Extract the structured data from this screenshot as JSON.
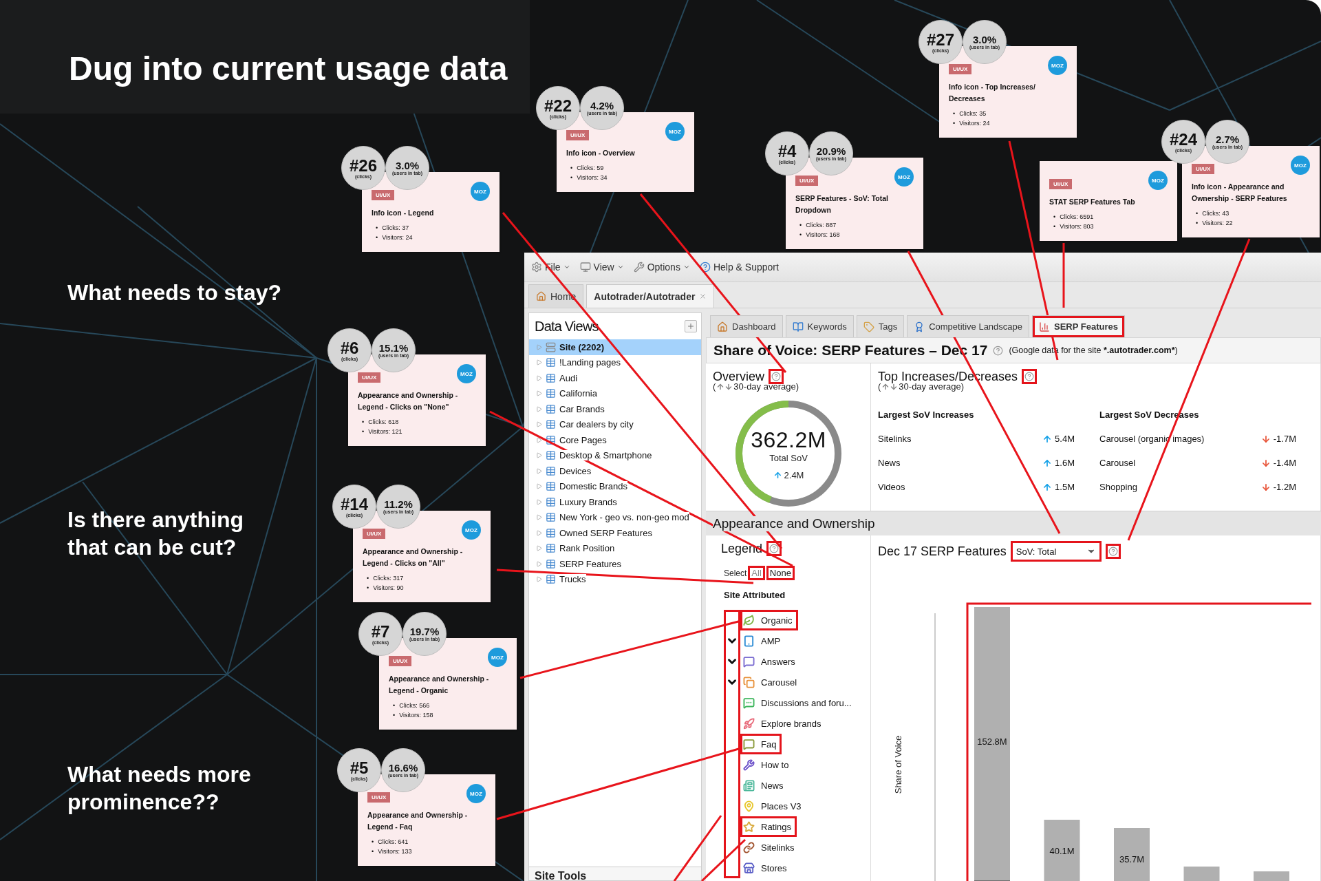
{
  "slide": {
    "title": "Dug into current usage data",
    "questions": [
      "What needs to stay?",
      "Is there anything\nthat can be cut?",
      "What needs more\nprominence??"
    ]
  },
  "notes": [
    {
      "rank": "#27",
      "rank_caption": "(clicks)",
      "share": "3.0%",
      "share_caption": "(users in tab)",
      "tag": "UI/UX",
      "logo": "MOZ",
      "title": "Info icon - Top Increases/ Decreases",
      "bullet": "•",
      "stats": [
        "Clicks: 35",
        "Visitors: 24"
      ]
    },
    {
      "rank": "#22",
      "rank_caption": "(clicks)",
      "share": "4.2%",
      "share_caption": "(users in tab)",
      "tag": "UI/UX",
      "logo": "MOZ",
      "title": "Info icon - Overview",
      "bullet": "•",
      "stats": [
        "Clicks: 59",
        "Visitors: 34"
      ]
    },
    {
      "rank": "#24",
      "rank_caption": "(clicks)",
      "share": "2.7%",
      "share_caption": "(users in tab)",
      "tag": "UI/UX",
      "logo": "MOZ",
      "title": "Info icon - Appearance and Ownership - SERP Features",
      "bullet": "•",
      "stats": [
        "Clicks: 43",
        "Visitors: 22"
      ]
    },
    {
      "rank": "#4",
      "rank_caption": "(clicks)",
      "share": "20.9%",
      "share_caption": "(users in tab)",
      "tag": "UI/UX",
      "logo": "MOZ",
      "title": "SERP Features - SoV: Total Dropdown",
      "bullet": "•",
      "stats": [
        "Clicks: 887",
        "Visitors: 168"
      ]
    },
    {
      "tag": "UI/UX",
      "logo": "MOZ",
      "title": "STAT SERP Features Tab",
      "bullet": "•",
      "stats": [
        "Clicks: 6591",
        "Visitors: 803"
      ]
    },
    {
      "rank": "#26",
      "rank_caption": "(clicks)",
      "share": "3.0%",
      "share_caption": "(users in tab)",
      "tag": "UI/UX",
      "logo": "MOZ",
      "title": "Info icon - Legend",
      "bullet": "•",
      "stats": [
        "Clicks: 37",
        "Visitors: 24"
      ]
    },
    {
      "rank": "#6",
      "rank_caption": "(clicks)",
      "share": "15.1%",
      "share_caption": "(users in tab)",
      "tag": "UI/UX",
      "logo": "MOZ",
      "title": "Appearance and Ownership - Legend - Clicks on \"None\"",
      "bullet": "•",
      "stats": [
        "Clicks: 618",
        "Visitors: 121"
      ]
    },
    {
      "rank": "#14",
      "rank_caption": "(clicks)",
      "share": "11.2%",
      "share_caption": "(users in tab)",
      "tag": "UI/UX",
      "logo": "MOZ",
      "title": "Appearance and Ownership - Legend - Clicks on \"All\"",
      "bullet": "•",
      "stats": [
        "Clicks: 317",
        "Visitors: 90"
      ]
    },
    {
      "rank": "#7",
      "rank_caption": "(clicks)",
      "share": "19.7%",
      "share_caption": "(users in tab)",
      "tag": "UI/UX",
      "logo": "MOZ",
      "title": "Appearance and Ownership - Legend - Organic",
      "bullet": "•",
      "stats": [
        "Clicks: 566",
        "Visitors: 158"
      ]
    },
    {
      "rank": "#5",
      "rank_caption": "(clicks)",
      "share": "16.6%",
      "share_caption": "(users in tab)",
      "tag": "UI/UX",
      "logo": "MOZ",
      "title": "Appearance and Ownership - Legend - Faq",
      "bullet": "•",
      "stats": [
        "Clicks: 641",
        "Visitors: 133"
      ]
    }
  ],
  "app": {
    "menu": [
      "File",
      "View",
      "Options",
      "Help & Support"
    ],
    "doc_tabs": [
      {
        "label": "Home",
        "selected": false
      },
      {
        "label": "Autotrader/Autotrader",
        "selected": true
      }
    ],
    "data_views": {
      "title": "Data Views",
      "items": [
        {
          "label": "Site (2202)",
          "selected": true
        },
        {
          "label": "!Landing pages",
          "selected": false
        },
        {
          "label": "Audi",
          "selected": false
        },
        {
          "label": "California",
          "selected": false
        },
        {
          "label": "Car Brands",
          "selected": false
        },
        {
          "label": "Car dealers by city",
          "selected": false
        },
        {
          "label": "Core Pages",
          "selected": false
        },
        {
          "label": "Desktop & Smartphone",
          "selected": false
        },
        {
          "label": "Devices",
          "selected": false
        },
        {
          "label": "Domestic Brands",
          "selected": false
        },
        {
          "label": "Luxury Brands",
          "selected": false
        },
        {
          "label": "New York - geo vs. non-geo mod",
          "selected": false
        },
        {
          "label": "Owned SERP Features",
          "selected": false
        },
        {
          "label": "Rank Position",
          "selected": false
        },
        {
          "label": "SERP Features",
          "selected": false
        },
        {
          "label": "Trucks",
          "selected": false
        }
      ],
      "footer": "Site Tools"
    },
    "subtabs": [
      {
        "label": "Dashboard",
        "selected": false,
        "highlighted": false
      },
      {
        "label": "Keywords",
        "selected": false,
        "highlighted": false
      },
      {
        "label": "Tags",
        "selected": false,
        "highlighted": false
      },
      {
        "label": "Competitive Landscape",
        "selected": false,
        "highlighted": false
      },
      {
        "label": "SERP Features",
        "selected": true,
        "highlighted": true
      }
    ],
    "heading": {
      "title": "Share of Voice: SERP Features – Dec 17",
      "note_prefix": "(Google data for the site",
      "note_site": "*.autotrader.com*",
      "note_suffix": ")"
    },
    "overview": {
      "title": "Overview",
      "help_highlighted": true,
      "subtitle_open": "(",
      "subtitle": "30-day average)",
      "value": "362.2M",
      "caption": "Total SoV",
      "change": "2.4M"
    },
    "top_changes": {
      "title": "Top Increases/Decreases",
      "help_highlighted": true,
      "subtitle_open": "(",
      "subtitle": "30-day average)",
      "columns": [
        {
          "kind": "increase",
          "header": "Largest SoV Increases",
          "rows": [
            {
              "label": "Sitelinks",
              "value": "5.4M"
            },
            {
              "label": "News",
              "value": "1.6M"
            },
            {
              "label": "Videos",
              "value": "1.5M"
            }
          ]
        },
        {
          "kind": "decrease",
          "header": "Largest SoV Decreases",
          "rows": [
            {
              "label": "Carousel (organic images)",
              "value": "-1.7M"
            },
            {
              "label": "Carousel",
              "value": "-1.4M"
            },
            {
              "label": "Shopping",
              "value": "-1.2M"
            }
          ]
        }
      ]
    },
    "section": "Appearance and Ownership",
    "legend": {
      "title": "Legend",
      "help_highlighted": true,
      "select_label": "Select",
      "select_options": [
        {
          "label": "All",
          "disabled": true,
          "highlighted": true
        },
        {
          "label": "None",
          "disabled": false,
          "highlighted": true
        }
      ],
      "group": "Site Attributed",
      "checks_highlighted": true,
      "items": [
        {
          "label": "Organic",
          "color": "#7cb342",
          "checked": false,
          "highlighted": true
        },
        {
          "label": "AMP",
          "color": "#2a8ad4",
          "checked": true,
          "highlighted": false
        },
        {
          "label": "Answers",
          "color": "#7b6cd1",
          "checked": true,
          "highlighted": false
        },
        {
          "label": "Carousel",
          "color": "#e8913a",
          "checked": true,
          "highlighted": false
        },
        {
          "label": "Discussions and foru...",
          "color": "#3cb55b",
          "checked": false,
          "highlighted": false
        },
        {
          "label": "Explore brands",
          "color": "#e86a7a",
          "checked": false,
          "highlighted": false
        },
        {
          "label": "Faq",
          "color": "#8a9a3a",
          "checked": false,
          "highlighted": true
        },
        {
          "label": "How to",
          "color": "#6a4fc9",
          "checked": false,
          "highlighted": false
        },
        {
          "label": "News",
          "color": "#4cb89a",
          "checked": false,
          "highlighted": false
        },
        {
          "label": "Places V3",
          "color": "#e8c72e",
          "checked": false,
          "highlighted": false
        },
        {
          "label": "Ratings",
          "color": "#d8a93a",
          "checked": false,
          "highlighted": true
        },
        {
          "label": "Sitelinks",
          "color": "#a0522d",
          "checked": false,
          "highlighted": false
        },
        {
          "label": "Stores",
          "color": "#5b5fc7",
          "checked": false,
          "highlighted": false
        }
      ]
    },
    "chart_panel": {
      "title": "Dec 17 SERP Features",
      "dropdown": "SoV: Total",
      "dropdown_highlighted": true,
      "help_highlighted": true,
      "plot_highlighted": true,
      "ylabel": "Share of Voice",
      "bar_labels": [
        "152.8M",
        "40.1M",
        "35.7M"
      ]
    }
  }
}
